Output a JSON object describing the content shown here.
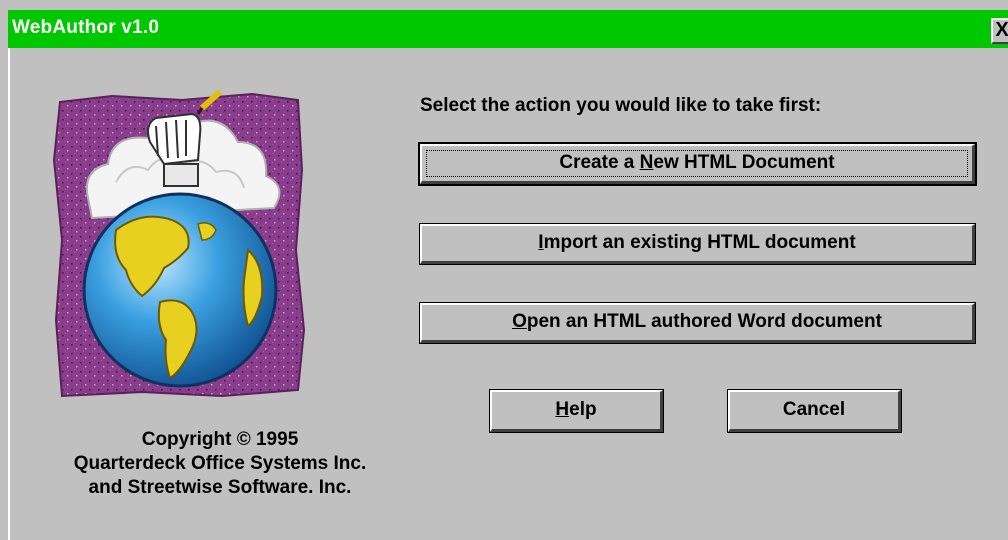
{
  "window": {
    "title": "WebAuthor v1.0",
    "close_label": "X"
  },
  "prompt": "Select the action you would like to take first:",
  "actions": {
    "create": {
      "pre": "Create a ",
      "accel": "N",
      "post": "ew HTML Document"
    },
    "import": {
      "pre": "",
      "accel": "I",
      "post": "mport an existing HTML document"
    },
    "open": {
      "pre": "",
      "accel": "O",
      "post": "pen an HTML authored Word document"
    }
  },
  "buttons": {
    "help": {
      "pre": "",
      "accel": "H",
      "post": "elp"
    },
    "cancel": {
      "label": "Cancel"
    }
  },
  "copyright": {
    "line1": "Copyright © 1995",
    "line2": "Quarterdeck Office Systems Inc.",
    "line3": "and Streetwise Software. Inc."
  },
  "colors": {
    "titlebar": "#00c800",
    "face": "#c0c0c0",
    "logo_background": "#8c3c8c",
    "globe_ocean": "#2a8fd0",
    "globe_land": "#e8d020"
  },
  "logo": {
    "icon": "globe-with-writing-hand-icon"
  }
}
